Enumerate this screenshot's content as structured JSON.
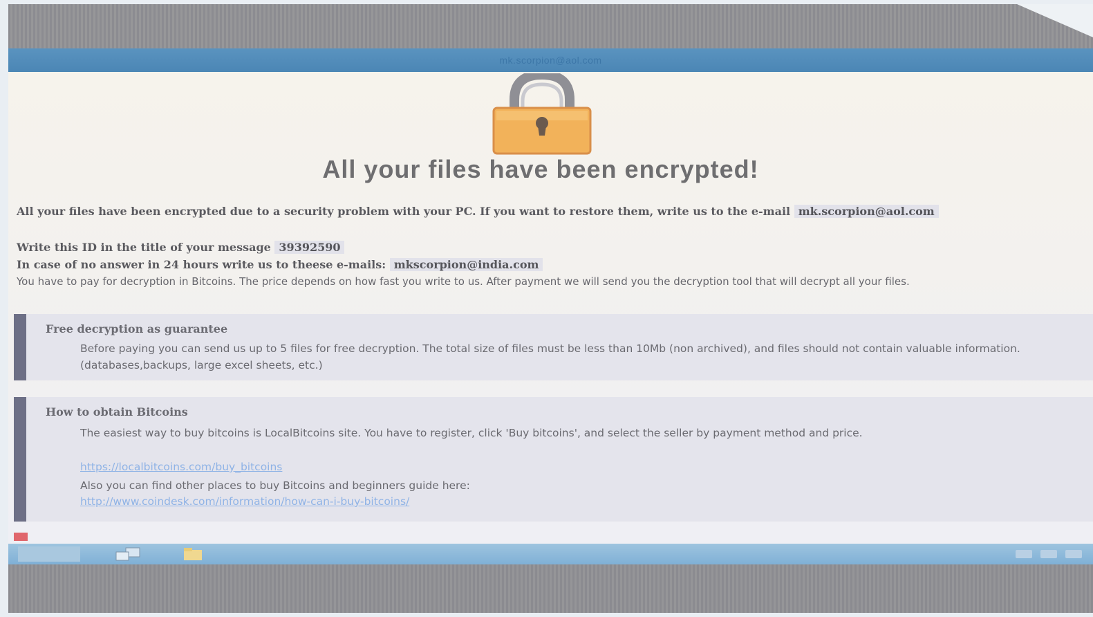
{
  "window": {
    "title": "mk.scorpion@aol.com"
  },
  "colors": {
    "title_bar": "#4b86b5",
    "accent_bar": "#6d6f86",
    "link": "#8fb3e6",
    "lock_body": "#f2b25a"
  },
  "headline": "All your files have been encrypted!",
  "intro": {
    "line1": "All your files have been encrypted due to a security problem with your PC. If you want to restore them, write us to the e-mail",
    "email": "mk.scorpion@aol.com",
    "id_label": "Write this ID in the title of your message",
    "id_value": "39392590",
    "backup_label": "In case of no answer in 24 hours write us to theese e-mails:",
    "backup_email": "mkscorpion@india.com",
    "payment_text": "You have to pay for decryption in Bitcoins. The price depends on how fast you write to us. After payment we will send you the decryption tool that will decrypt all your files."
  },
  "free_decryption": {
    "title": "Free decryption as guarantee",
    "body": "Before paying you can send us up to 5 files for free decryption. The total size of files must be less than 10Mb (non archived), and files should not contain valuable information. (databases,backups, large excel sheets, etc.)"
  },
  "obtain_bitcoins": {
    "title": "How to obtain Bitcoins",
    "body": "The easiest way to buy bitcoins is LocalBitcoins site. You have to register, click 'Buy bitcoins', and select the seller by payment method and price.",
    "link1": "https://localbitcoins.com/buy_bitcoins",
    "more_text": "Also you can find other places to buy Bitcoins and beginners guide here:",
    "link2": "http://www.coindesk.com/information/how-can-i-buy-bitcoins/"
  },
  "taskbar": {
    "icons": [
      "start-icon",
      "network-icon",
      "folder-icon"
    ],
    "tray_icons": [
      "flag-icon",
      "speaker-icon",
      "power-icon"
    ]
  }
}
